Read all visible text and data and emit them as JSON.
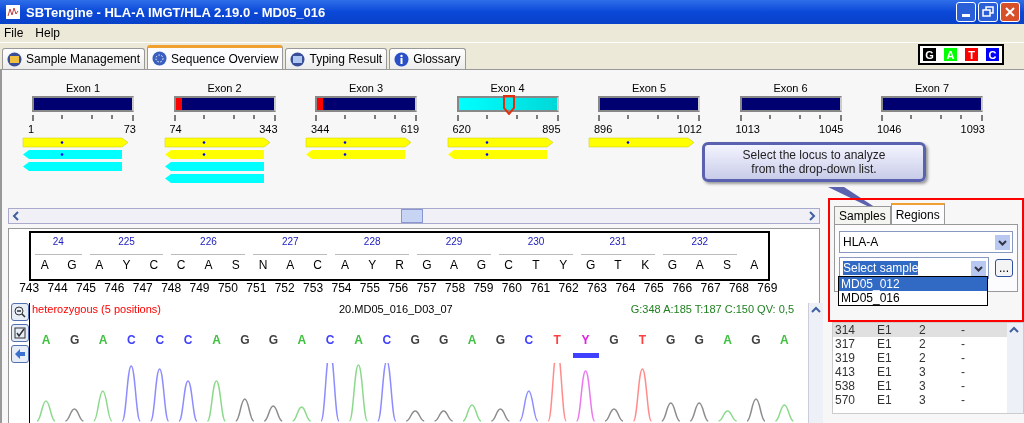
{
  "window": {
    "title": "SBTengine - HLA-A IMGT/HLA 2.19.0 - MD05_016"
  },
  "menu": [
    "File",
    "Help"
  ],
  "tabs": [
    {
      "label": "Sample Management",
      "selected": false
    },
    {
      "label": "Sequence Overview",
      "selected": true
    },
    {
      "label": "Typing Result",
      "selected": false
    },
    {
      "label": "Glossary",
      "selected": false
    }
  ],
  "base_legend": [
    {
      "label": "G",
      "color": "#000000"
    },
    {
      "label": "A",
      "color": "#00ff00"
    },
    {
      "label": "T",
      "color": "#ff0000"
    },
    {
      "label": "C",
      "color": "#0000ff"
    }
  ],
  "exons": [
    {
      "label": "Exon 1",
      "start": "1",
      "end": "73",
      "selected": false,
      "mismatch": false,
      "reads": [
        {
          "kind": "forward",
          "color": "#ffff00"
        },
        {
          "kind": "reverse",
          "color": "#00ffff"
        },
        {
          "kind": "reverse",
          "color": "#00ffff"
        }
      ]
    },
    {
      "label": "Exon 2",
      "start": "74",
      "end": "343",
      "selected": false,
      "mismatch": true,
      "reads": [
        {
          "kind": "forward",
          "color": "#ffff00"
        },
        {
          "kind": "reverse",
          "color": "#ffff00"
        },
        {
          "kind": "reverse",
          "color": "#00ffff"
        },
        {
          "kind": "reverse",
          "color": "#00ffff"
        }
      ]
    },
    {
      "label": "Exon 3",
      "start": "344",
      "end": "619",
      "selected": false,
      "mismatch": true,
      "reads": [
        {
          "kind": "forward",
          "color": "#ffff00"
        },
        {
          "kind": "reverse",
          "color": "#ffff00"
        }
      ]
    },
    {
      "label": "Exon 4",
      "start": "620",
      "end": "895",
      "selected": true,
      "mismatch": false,
      "reads": [
        {
          "kind": "forward",
          "color": "#ffff00"
        },
        {
          "kind": "reverse",
          "color": "#ffff00"
        }
      ]
    },
    {
      "label": "Exon 5",
      "start": "896",
      "end": "1012",
      "selected": false,
      "mismatch": false,
      "reads": [
        {
          "kind": "forward",
          "color": "#ffff00"
        }
      ]
    },
    {
      "label": "Exon 6",
      "start": "1013",
      "end": "1045",
      "selected": false,
      "mismatch": false
    },
    {
      "label": "Exon 7",
      "start": "1046",
      "end": "1093",
      "selected": false,
      "mismatch": false
    }
  ],
  "callout": "Select the locus to analyze from the drop-down list.",
  "sequence": {
    "codons": [
      "24",
      "225",
      "226",
      "227",
      "228",
      "229",
      "230",
      "231",
      "232"
    ],
    "bases": [
      "A",
      "G",
      "A",
      "Y",
      "C",
      "C",
      "A",
      "S",
      "N",
      "A",
      "C",
      "A",
      "Y",
      "R",
      "G",
      "A",
      "G",
      "C",
      "T",
      "Y",
      "G",
      "T",
      "K",
      "G",
      "A",
      "S",
      "A"
    ],
    "positions": [
      "743",
      "744",
      "745",
      "746",
      "747",
      "748",
      "749",
      "750",
      "751",
      "752",
      "753",
      "754",
      "755",
      "756",
      "757",
      "758",
      "759",
      "760",
      "761",
      "762",
      "763",
      "764",
      "765",
      "766",
      "767",
      "768",
      "769"
    ]
  },
  "chromatogram": {
    "status": "heterozygous (5 positions)",
    "sample": "20.MD05_016_D03_07",
    "stats": "G:348 A:185 T:187 C:150 QV: 0,5",
    "calls": [
      {
        "base": "A",
        "color": "#40c040",
        "selected": false
      },
      {
        "base": "G",
        "color": "#404040",
        "selected": false
      },
      {
        "base": "A",
        "color": "#40c040",
        "selected": false
      },
      {
        "base": "C",
        "color": "#4040ff",
        "selected": false
      },
      {
        "base": "C",
        "color": "#4040ff",
        "selected": false
      },
      {
        "base": "C",
        "color": "#4040ff",
        "selected": false
      },
      {
        "base": "A",
        "color": "#40c040",
        "selected": false
      },
      {
        "base": "G",
        "color": "#404040",
        "selected": false
      },
      {
        "base": "G",
        "color": "#404040",
        "selected": false
      },
      {
        "base": "A",
        "color": "#40c040",
        "selected": false
      },
      {
        "base": "C",
        "color": "#4040ff",
        "selected": false
      },
      {
        "base": "A",
        "color": "#40c040",
        "selected": false
      },
      {
        "base": "C",
        "color": "#4040ff",
        "selected": false
      },
      {
        "base": "G",
        "color": "#404040",
        "selected": false
      },
      {
        "base": "G",
        "color": "#404040",
        "selected": false
      },
      {
        "base": "A",
        "color": "#40c040",
        "selected": false
      },
      {
        "base": "G",
        "color": "#404040",
        "selected": false
      },
      {
        "base": "C",
        "color": "#4040ff",
        "selected": false
      },
      {
        "base": "T",
        "color": "#ff4040",
        "selected": false
      },
      {
        "base": "Y",
        "color": "#e020e0",
        "selected": true
      },
      {
        "base": "G",
        "color": "#404040",
        "selected": false
      },
      {
        "base": "T",
        "color": "#ff4040",
        "selected": false
      },
      {
        "base": "G",
        "color": "#404040",
        "selected": false
      },
      {
        "base": "G",
        "color": "#404040",
        "selected": false
      },
      {
        "base": "A",
        "color": "#40c040",
        "selected": false
      },
      {
        "base": "G",
        "color": "#404040",
        "selected": false
      },
      {
        "base": "A",
        "color": "#40c040",
        "selected": false
      }
    ]
  },
  "side_panel": {
    "tabs": [
      {
        "label": "Samples",
        "selected": false
      },
      {
        "label": "Regions",
        "selected": true
      }
    ],
    "locus": "HLA-A",
    "sample_field": {
      "value": "Select sample"
    },
    "browse_button": "...",
    "dropdown": [
      {
        "label": "MD05_012",
        "selected": true
      },
      {
        "label": "MD05_016",
        "selected": false
      }
    ],
    "rows": [
      {
        "cells": [
          "314",
          "E1",
          "2",
          "-"
        ],
        "selected": true
      },
      {
        "cells": [
          "317",
          "E1",
          "2",
          "-"
        ],
        "selected": false
      },
      {
        "cells": [
          "319",
          "E1",
          "2",
          "-"
        ],
        "selected": false
      },
      {
        "cells": [
          "413",
          "E1",
          "3",
          "-"
        ],
        "selected": false
      },
      {
        "cells": [
          "538",
          "E1",
          "3",
          "-"
        ],
        "selected": false
      },
      {
        "cells": [
          "570",
          "E1",
          "3",
          "-"
        ],
        "selected": false
      }
    ]
  }
}
